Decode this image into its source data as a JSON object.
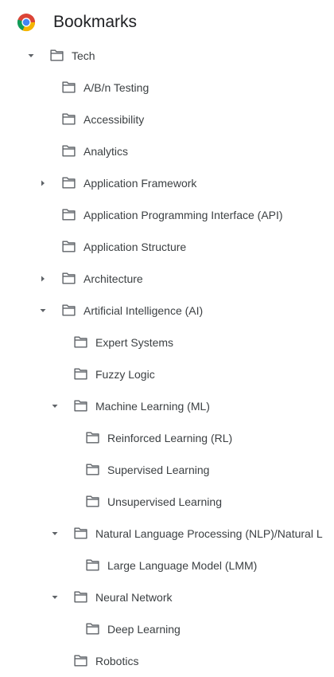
{
  "header": {
    "title": "Bookmarks",
    "logo_icon": "chrome-logo-icon"
  },
  "colors": {
    "text": "#3c4043",
    "icon": "#5f6368",
    "chrome_red": "#db4437",
    "chrome_yellow": "#f4b400",
    "chrome_green": "#0f9d58",
    "chrome_blue": "#4285f4"
  },
  "tree": [
    {
      "label": "Tech",
      "level": 0,
      "toggle": "expanded",
      "name": "tech"
    },
    {
      "label": "A/B/n Testing",
      "level": 1,
      "toggle": "none",
      "name": "ab-n-testing"
    },
    {
      "label": "Accessibility",
      "level": 1,
      "toggle": "none",
      "name": "accessibility"
    },
    {
      "label": "Analytics",
      "level": 1,
      "toggle": "none",
      "name": "analytics"
    },
    {
      "label": "Application Framework",
      "level": 1,
      "toggle": "collapsed",
      "name": "application-framework"
    },
    {
      "label": "Application Programming Interface (API)",
      "level": 1,
      "toggle": "none",
      "name": "application-programming-interface"
    },
    {
      "label": "Application Structure",
      "level": 1,
      "toggle": "none",
      "name": "application-structure"
    },
    {
      "label": "Architecture",
      "level": 1,
      "toggle": "collapsed",
      "name": "architecture"
    },
    {
      "label": "Artificial Intelligence (AI)",
      "level": 1,
      "toggle": "expanded",
      "name": "artificial-intelligence"
    },
    {
      "label": "Expert Systems",
      "level": 2,
      "toggle": "none",
      "name": "expert-systems"
    },
    {
      "label": "Fuzzy Logic",
      "level": 2,
      "toggle": "none",
      "name": "fuzzy-logic"
    },
    {
      "label": "Machine Learning (ML)",
      "level": 2,
      "toggle": "expanded",
      "name": "machine-learning"
    },
    {
      "label": "Reinforced Learning (RL)",
      "level": 3,
      "toggle": "none",
      "name": "reinforced-learning"
    },
    {
      "label": "Supervised Learning",
      "level": 3,
      "toggle": "none",
      "name": "supervised-learning"
    },
    {
      "label": "Unsupervised Learning",
      "level": 3,
      "toggle": "none",
      "name": "unsupervised-learning"
    },
    {
      "label": "Natural Language Processing (NLP)/Natural L",
      "level": 2,
      "toggle": "expanded",
      "name": "natural-language-processing"
    },
    {
      "label": "Large Language Model (LMM)",
      "level": 3,
      "toggle": "none",
      "name": "large-language-model"
    },
    {
      "label": "Neural Network",
      "level": 2,
      "toggle": "expanded",
      "name": "neural-network"
    },
    {
      "label": "Deep Learning",
      "level": 3,
      "toggle": "none",
      "name": "deep-learning"
    },
    {
      "label": "Robotics",
      "level": 2,
      "toggle": "none",
      "name": "robotics"
    }
  ]
}
